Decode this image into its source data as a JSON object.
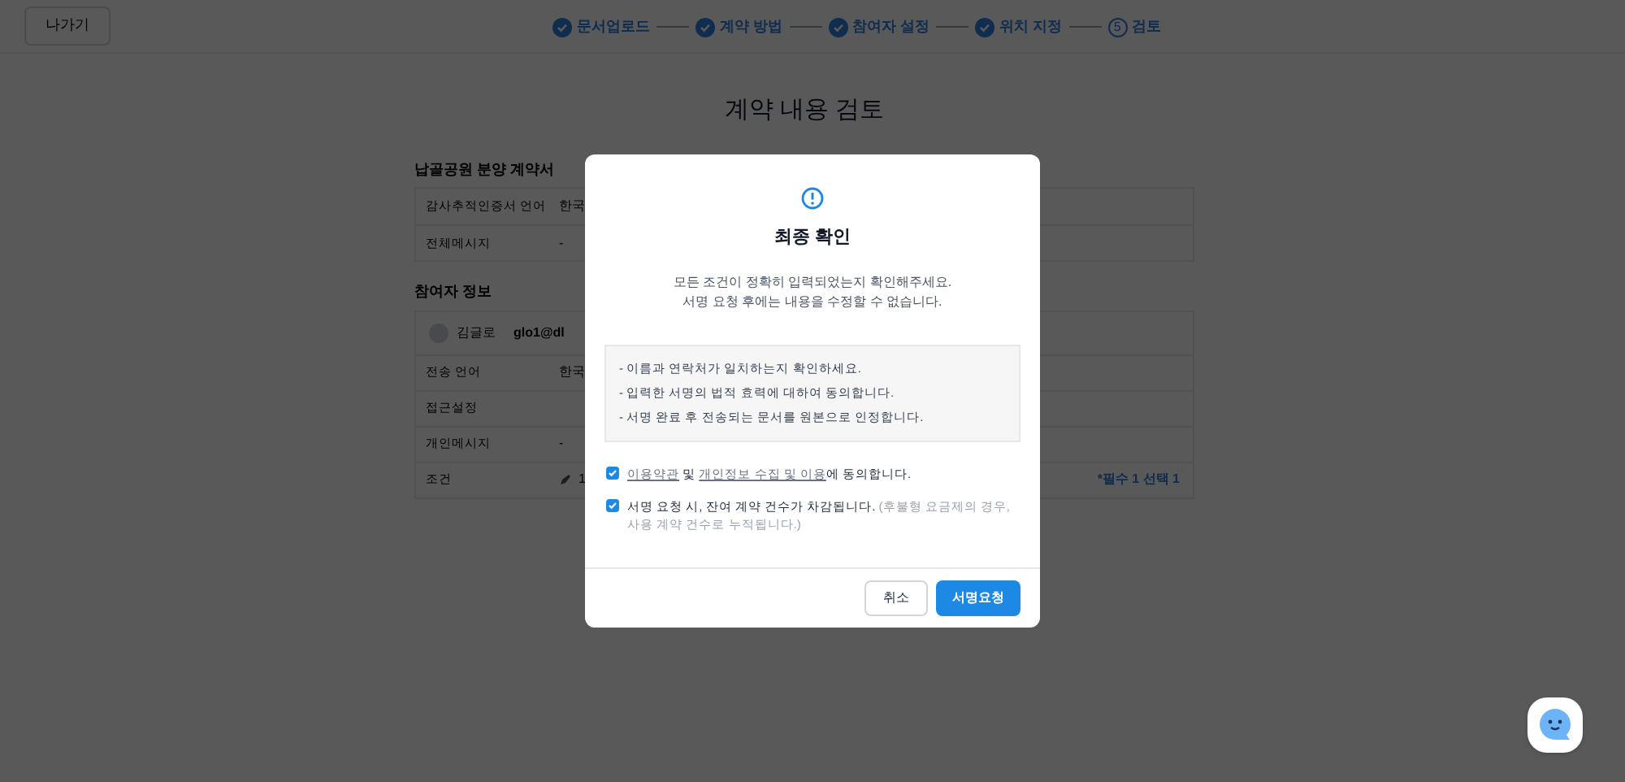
{
  "header": {
    "back_button": "나가기",
    "steps": [
      {
        "label": "문서업로드",
        "done": true
      },
      {
        "label": "계약 방법",
        "done": true
      },
      {
        "label": "참여자 설정",
        "done": true
      },
      {
        "label": "위치 지정",
        "done": true
      },
      {
        "number": "5",
        "label": "검토",
        "done": false
      }
    ]
  },
  "page_title": "계약 내용 검토",
  "document": {
    "title": "납골공원 분양 계약서",
    "rows": [
      {
        "label": "감사추적인증서 언어",
        "value": "한국"
      },
      {
        "label": "전체메시지",
        "value": "-"
      }
    ]
  },
  "participants": {
    "title": "참여자 정보",
    "name": "김글로",
    "email": "glo1@dl",
    "rows": [
      {
        "kind": "text",
        "label": "전송 언어",
        "value": "한국"
      },
      {
        "kind": "text",
        "label": "접근설정",
        "value": ""
      },
      {
        "kind": "text",
        "label": "개인메시지",
        "value": "-"
      },
      {
        "kind": "condition",
        "label": "조건",
        "value": "1",
        "summary": "*필수 1 선택 1"
      }
    ]
  },
  "dialog": {
    "title": "최종 확인",
    "description": [
      "모든 조건이 정확히 입력되었는지 확인해주세요.",
      "서명 요청 후에는 내용을 수정할 수 없습니다."
    ],
    "notices": [
      "- 이름과 연락처가 일치하는지 확인하세요.",
      "- 입력한 서명의 법적 효력에 대하여 동의합니다.",
      "- 서명 완료 후 전송되는 문서를 원본으로 인정합니다."
    ],
    "agreements": [
      {
        "kind": "links",
        "links": [
          "이용약관",
          "개인정보 수집 및 이용"
        ],
        "joiner": "및",
        "suffix": "에 동의합니다.",
        "checked": true
      },
      {
        "kind": "note",
        "text": "서명 요청 시, 잔여 계약 건수가 차감됩니다.",
        "note": "(후불형 요금제의 경우, 사용 계약 건수로 누적됩니다.)",
        "checked": true
      }
    ],
    "cancel_button": "취소",
    "confirm_button": "서명요청"
  }
}
